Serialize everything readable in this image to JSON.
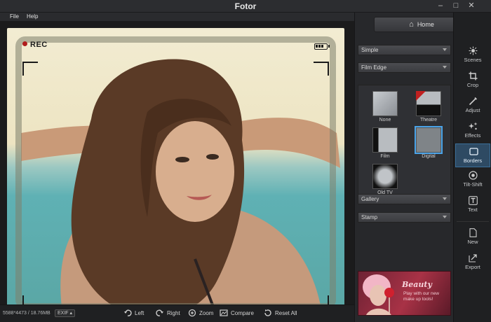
{
  "app": {
    "title": "Fotor"
  },
  "window_controls": {
    "minimize": "–",
    "maximize": "□",
    "close": "✕"
  },
  "menu": {
    "file": "File",
    "help": "Help"
  },
  "viewer": {
    "rec_label": "REC"
  },
  "status": {
    "image_info": "5588*4473 / 18.76MB",
    "exif": "EXIF",
    "buttons": {
      "left": "Left",
      "right": "Right",
      "zoom": "Zoom",
      "compare": "Compare",
      "reset_all": "Reset All"
    }
  },
  "panel": {
    "home": "Home",
    "sections": {
      "simple": "Simple",
      "film_edge": "Film Edge",
      "gallery": "Gallery",
      "stamp": "Stamp"
    },
    "film_edge_items": [
      {
        "label": "None"
      },
      {
        "label": "Theatre",
        "badge": "NEW"
      },
      {
        "label": "Film"
      },
      {
        "label": "Digital",
        "selected": true
      },
      {
        "label": "Old TV"
      }
    ],
    "ad": {
      "title": "Beauty",
      "text": "Play with our new make up tools!"
    }
  },
  "tools": [
    {
      "label": "Scenes",
      "icon": "scenes-icon"
    },
    {
      "label": "Crop",
      "icon": "crop-icon"
    },
    {
      "label": "Adjust",
      "icon": "adjust-icon"
    },
    {
      "label": "Effects",
      "icon": "effects-icon"
    },
    {
      "label": "Borders",
      "icon": "borders-icon",
      "active": true
    },
    {
      "label": "Tilt-Shift",
      "icon": "tilt-shift-icon"
    },
    {
      "label": "Text",
      "icon": "text-icon"
    },
    {
      "label": "New",
      "icon": "new-icon"
    },
    {
      "label": "Export",
      "icon": "export-icon"
    }
  ],
  "colors": {
    "accent": "#3b6f99",
    "selected_outline": "#4aa3e8",
    "rec_dot": "#b01c1c"
  }
}
